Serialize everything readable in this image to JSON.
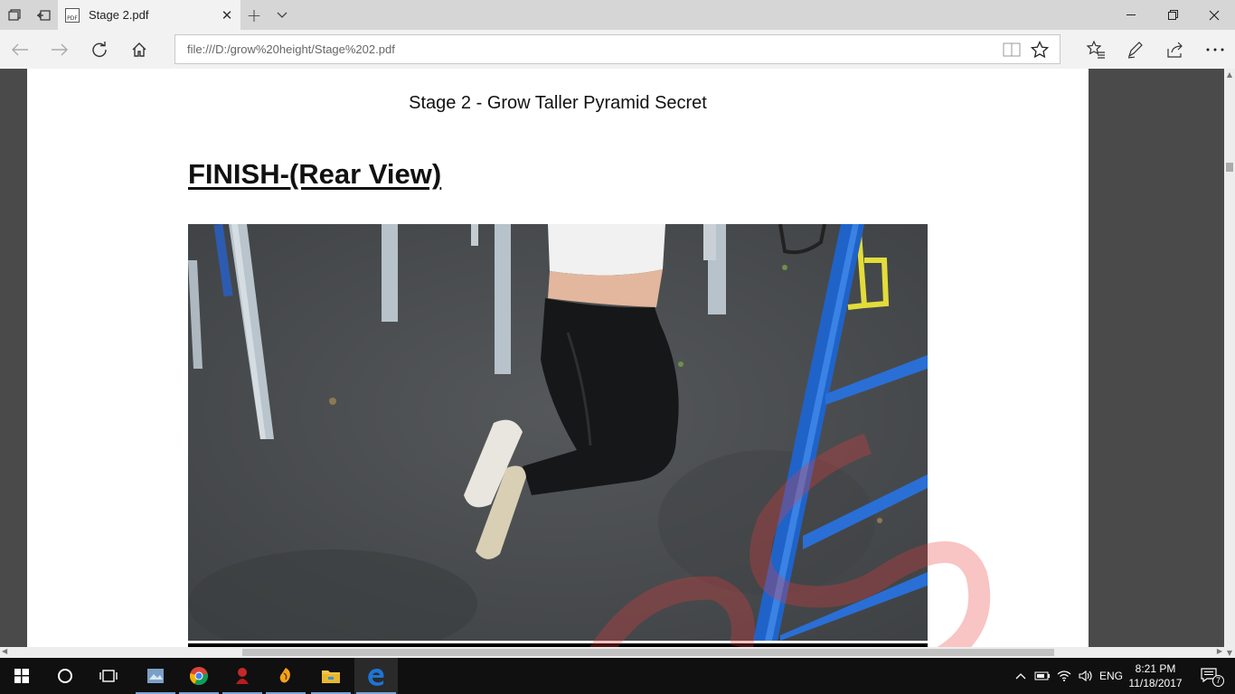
{
  "browser": {
    "tab": {
      "title": "Stage 2.pdf",
      "favicon": "pdf-icon"
    },
    "address_bar": {
      "url": "file:///D:/grow%20height/Stage%202.pdf"
    },
    "icons": {
      "tab_preview": "tab-preview-icon",
      "set_aside": "set-aside-icon",
      "new_tab": "plus-icon",
      "tab_list": "chevron-down-icon",
      "minimize": "minimize-icon",
      "restore": "restore-icon",
      "close": "close-icon",
      "back": "back-arrow-icon",
      "forward": "forward-arrow-icon",
      "refresh": "refresh-icon",
      "home": "home-icon",
      "reading_view": "reading-view-icon",
      "favorite": "star-icon",
      "favorites_hub": "favorites-list-icon",
      "notes": "pen-icon",
      "share": "share-icon",
      "more": "more-icon"
    }
  },
  "document": {
    "header": "Stage 2 - Grow Taller Pyramid Secret",
    "section_title": "FINISH-(Rear View)",
    "watermark_color": "#e83a3a"
  },
  "taskbar": {
    "items": [
      {
        "name": "start-icon"
      },
      {
        "name": "cortana-icon"
      },
      {
        "name": "task-view-icon"
      },
      {
        "name": "app-icon"
      },
      {
        "name": "chrome-icon"
      },
      {
        "name": "app2-icon"
      },
      {
        "name": "fl-studio-icon"
      },
      {
        "name": "file-explorer-icon"
      },
      {
        "name": "edge-icon"
      }
    ],
    "language": "ENG",
    "time": "8:21 PM",
    "date": "11/18/2017",
    "notifications_count": "7"
  },
  "colors": {
    "accent": "#1e74d6",
    "tab_bar": "#d6d6d6",
    "viewer_bg": "#4a4a4a"
  }
}
